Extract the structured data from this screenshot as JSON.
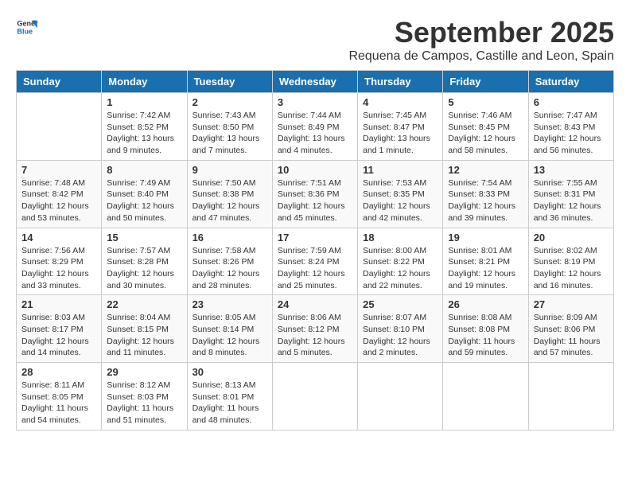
{
  "header": {
    "logo_general": "General",
    "logo_blue": "Blue",
    "month": "September 2025",
    "location": "Requena de Campos, Castille and Leon, Spain"
  },
  "weekdays": [
    "Sunday",
    "Monday",
    "Tuesday",
    "Wednesday",
    "Thursday",
    "Friday",
    "Saturday"
  ],
  "weeks": [
    [
      {
        "day": "",
        "content": ""
      },
      {
        "day": "1",
        "content": "Sunrise: 7:42 AM\nSunset: 8:52 PM\nDaylight: 13 hours\nand 9 minutes."
      },
      {
        "day": "2",
        "content": "Sunrise: 7:43 AM\nSunset: 8:50 PM\nDaylight: 13 hours\nand 7 minutes."
      },
      {
        "day": "3",
        "content": "Sunrise: 7:44 AM\nSunset: 8:49 PM\nDaylight: 13 hours\nand 4 minutes."
      },
      {
        "day": "4",
        "content": "Sunrise: 7:45 AM\nSunset: 8:47 PM\nDaylight: 13 hours\nand 1 minute."
      },
      {
        "day": "5",
        "content": "Sunrise: 7:46 AM\nSunset: 8:45 PM\nDaylight: 12 hours\nand 58 minutes."
      },
      {
        "day": "6",
        "content": "Sunrise: 7:47 AM\nSunset: 8:43 PM\nDaylight: 12 hours\nand 56 minutes."
      }
    ],
    [
      {
        "day": "7",
        "content": "Sunrise: 7:48 AM\nSunset: 8:42 PM\nDaylight: 12 hours\nand 53 minutes."
      },
      {
        "day": "8",
        "content": "Sunrise: 7:49 AM\nSunset: 8:40 PM\nDaylight: 12 hours\nand 50 minutes."
      },
      {
        "day": "9",
        "content": "Sunrise: 7:50 AM\nSunset: 8:38 PM\nDaylight: 12 hours\nand 47 minutes."
      },
      {
        "day": "10",
        "content": "Sunrise: 7:51 AM\nSunset: 8:36 PM\nDaylight: 12 hours\nand 45 minutes."
      },
      {
        "day": "11",
        "content": "Sunrise: 7:53 AM\nSunset: 8:35 PM\nDaylight: 12 hours\nand 42 minutes."
      },
      {
        "day": "12",
        "content": "Sunrise: 7:54 AM\nSunset: 8:33 PM\nDaylight: 12 hours\nand 39 minutes."
      },
      {
        "day": "13",
        "content": "Sunrise: 7:55 AM\nSunset: 8:31 PM\nDaylight: 12 hours\nand 36 minutes."
      }
    ],
    [
      {
        "day": "14",
        "content": "Sunrise: 7:56 AM\nSunset: 8:29 PM\nDaylight: 12 hours\nand 33 minutes."
      },
      {
        "day": "15",
        "content": "Sunrise: 7:57 AM\nSunset: 8:28 PM\nDaylight: 12 hours\nand 30 minutes."
      },
      {
        "day": "16",
        "content": "Sunrise: 7:58 AM\nSunset: 8:26 PM\nDaylight: 12 hours\nand 28 minutes."
      },
      {
        "day": "17",
        "content": "Sunrise: 7:59 AM\nSunset: 8:24 PM\nDaylight: 12 hours\nand 25 minutes."
      },
      {
        "day": "18",
        "content": "Sunrise: 8:00 AM\nSunset: 8:22 PM\nDaylight: 12 hours\nand 22 minutes."
      },
      {
        "day": "19",
        "content": "Sunrise: 8:01 AM\nSunset: 8:21 PM\nDaylight: 12 hours\nand 19 minutes."
      },
      {
        "day": "20",
        "content": "Sunrise: 8:02 AM\nSunset: 8:19 PM\nDaylight: 12 hours\nand 16 minutes."
      }
    ],
    [
      {
        "day": "21",
        "content": "Sunrise: 8:03 AM\nSunset: 8:17 PM\nDaylight: 12 hours\nand 14 minutes."
      },
      {
        "day": "22",
        "content": "Sunrise: 8:04 AM\nSunset: 8:15 PM\nDaylight: 12 hours\nand 11 minutes."
      },
      {
        "day": "23",
        "content": "Sunrise: 8:05 AM\nSunset: 8:14 PM\nDaylight: 12 hours\nand 8 minutes."
      },
      {
        "day": "24",
        "content": "Sunrise: 8:06 AM\nSunset: 8:12 PM\nDaylight: 12 hours\nand 5 minutes."
      },
      {
        "day": "25",
        "content": "Sunrise: 8:07 AM\nSunset: 8:10 PM\nDaylight: 12 hours\nand 2 minutes."
      },
      {
        "day": "26",
        "content": "Sunrise: 8:08 AM\nSunset: 8:08 PM\nDaylight: 11 hours\nand 59 minutes."
      },
      {
        "day": "27",
        "content": "Sunrise: 8:09 AM\nSunset: 8:06 PM\nDaylight: 11 hours\nand 57 minutes."
      }
    ],
    [
      {
        "day": "28",
        "content": "Sunrise: 8:11 AM\nSunset: 8:05 PM\nDaylight: 11 hours\nand 54 minutes."
      },
      {
        "day": "29",
        "content": "Sunrise: 8:12 AM\nSunset: 8:03 PM\nDaylight: 11 hours\nand 51 minutes."
      },
      {
        "day": "30",
        "content": "Sunrise: 8:13 AM\nSunset: 8:01 PM\nDaylight: 11 hours\nand 48 minutes."
      },
      {
        "day": "",
        "content": ""
      },
      {
        "day": "",
        "content": ""
      },
      {
        "day": "",
        "content": ""
      },
      {
        "day": "",
        "content": ""
      }
    ]
  ]
}
